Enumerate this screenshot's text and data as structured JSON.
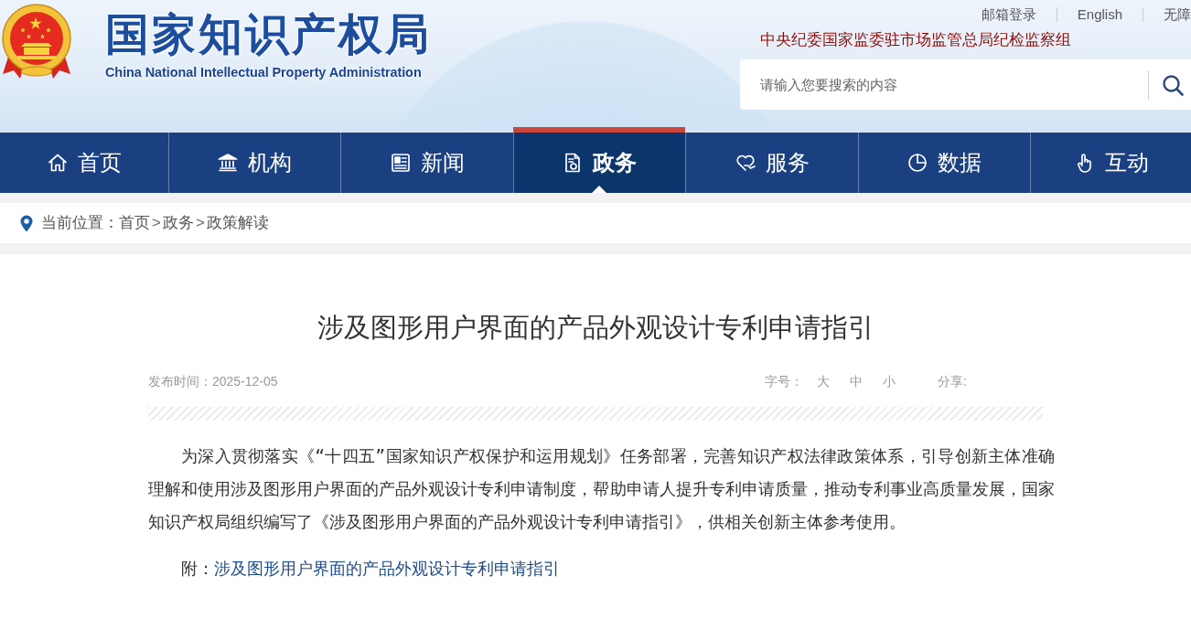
{
  "header": {
    "title": "国家知识产权局",
    "subtitle": "China National Intellectual Property Administration",
    "top_links": [
      "邮箱登录",
      "English",
      "无障"
    ],
    "notice": "中央纪委国家监委驻市场监管总局纪检监察组",
    "search": {
      "placeholder": "请输入您要搜索的内容"
    }
  },
  "nav": [
    {
      "label": "首页",
      "selected": false
    },
    {
      "label": "机构",
      "selected": false
    },
    {
      "label": "新闻",
      "selected": false
    },
    {
      "label": "政务",
      "selected": true
    },
    {
      "label": "服务",
      "selected": false
    },
    {
      "label": "数据",
      "selected": false
    },
    {
      "label": "互动",
      "selected": false
    }
  ],
  "breadcrumb": {
    "label": "当前位置：",
    "items": [
      {
        "kind": "link",
        "text": "首页"
      },
      {
        "kind": "separator",
        "text": ">"
      },
      {
        "kind": "link",
        "text": "政务"
      },
      {
        "kind": "separator",
        "text": ">"
      },
      {
        "kind": "link",
        "text": "政策解读"
      }
    ]
  },
  "article": {
    "title": "涉及图形用户界面的产品外观设计专利申请指引",
    "publish_date": "发布时间：2025-12-05",
    "font_size_label": "字号：",
    "font_sizes": [
      "大",
      "中",
      "小"
    ],
    "share_label": "分享:",
    "paragraphs": [
      "为深入贯彻落实《“十四五”国家知识产权保护和运用规划》任务部署，完善知识产权法律政策体系，引导创新主体准确理解和使用涉及图形用户界面的产品外观设计专利申请制度，帮助申请人提升专利申请质量，推动专利事业高质量发展，国家知识产权局组织编写了《涉及图形用户界面的产品外观设计专利申请指引》，供相关创新主体参考使用。"
    ],
    "attachment": {
      "label": "附：",
      "link": "涉及图形用户界面的产品外观设计专利申请指引"
    }
  }
}
